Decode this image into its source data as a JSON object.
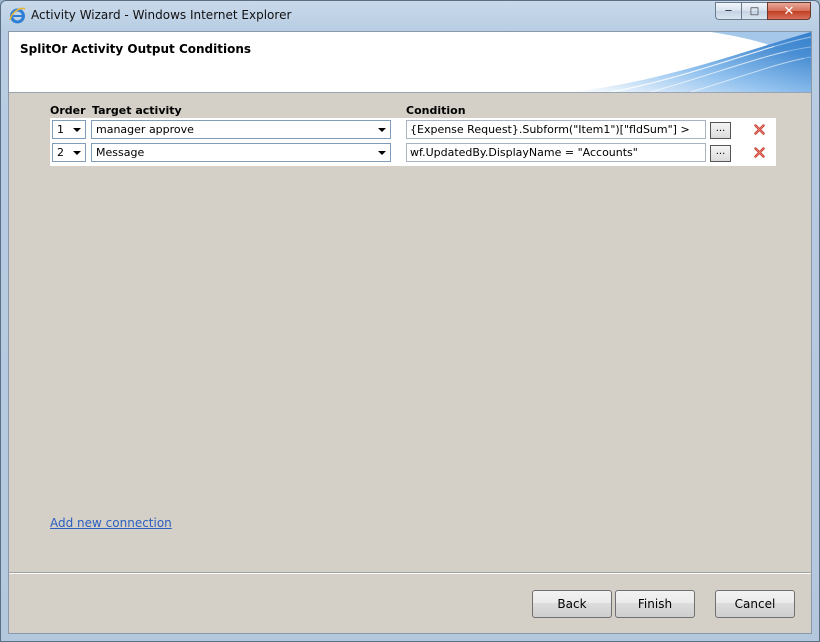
{
  "window": {
    "title": "Activity Wizard - Windows Internet Explorer"
  },
  "header": {
    "title": "SplitOr Activity Output Conditions"
  },
  "columns": {
    "order": "Order",
    "target": "Target activity",
    "condition": "Condition"
  },
  "rows": [
    {
      "order": "1",
      "target": "manager approve",
      "condition": "{Expense Request}.Subform(\"Item1\")[\"fldSum\"] >",
      "browse_label": "..."
    },
    {
      "order": "2",
      "target": "Message",
      "condition": "wf.UpdatedBy.DisplayName = \"Accounts\"",
      "browse_label": "..."
    }
  ],
  "links": {
    "add_connection": "Add new connection"
  },
  "buttons": {
    "back": "Back",
    "finish": "Finish",
    "cancel": "Cancel"
  },
  "icons": {
    "app": "ie-icon",
    "delete": "delete-x-icon"
  },
  "colors": {
    "link": "#2c5fbf",
    "delete": "#c0392b",
    "header_accent": "#2f78c4"
  }
}
